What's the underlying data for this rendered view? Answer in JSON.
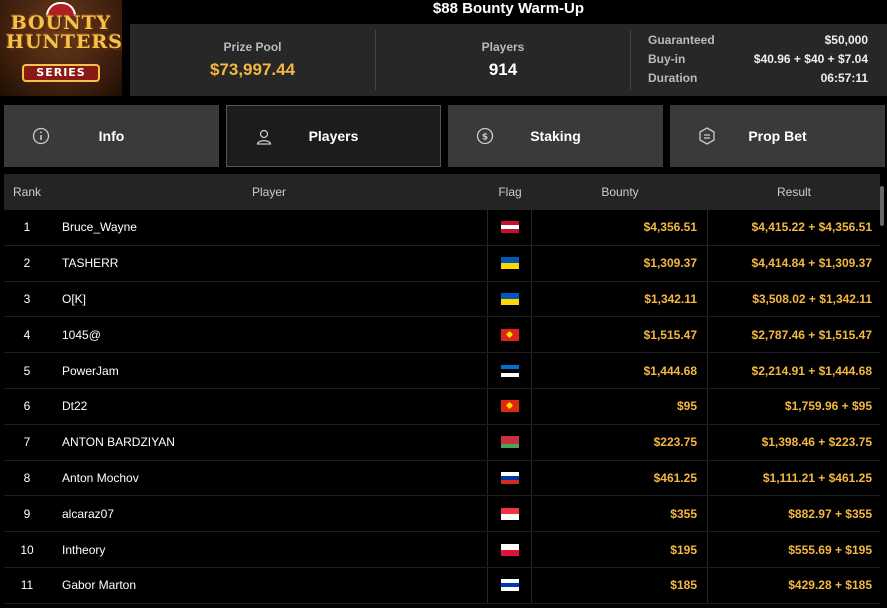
{
  "title": "$88 Bounty Warm-Up",
  "logo": {
    "line1": "BOUNTY",
    "line2": "HUNTERS",
    "line3": "SERIES"
  },
  "summary": {
    "prize_pool_label": "Prize Pool",
    "prize_pool_value": "$73,997.44",
    "players_label": "Players",
    "players_value": "914",
    "details": [
      {
        "label": "Guaranteed",
        "value": "$50,000"
      },
      {
        "label": "Buy-in",
        "value": "$40.96 + $40 + $7.04"
      },
      {
        "label": "Duration",
        "value": "06:57:11"
      }
    ]
  },
  "tabs": [
    {
      "label": "Info",
      "icon": "info-icon"
    },
    {
      "label": "Players",
      "icon": "user-icon",
      "active": true
    },
    {
      "label": "Staking",
      "icon": "staking-icon"
    },
    {
      "label": "Prop Bet",
      "icon": "prop-bet-icon"
    }
  ],
  "table": {
    "headers": {
      "rank": "Rank",
      "player": "Player",
      "flag": "Flag",
      "bounty": "Bounty",
      "result": "Result"
    },
    "rows": [
      {
        "rank": "1",
        "player": "Bruce_Wayne",
        "flag": [
          "#c8102e",
          "#ffffff",
          "#c8102e"
        ],
        "bounty": "$4,356.51",
        "result": "$4,415.22 + $4,356.51"
      },
      {
        "rank": "2",
        "player": "TASHERR",
        "flag": [
          "#0057b7",
          "#ffd700"
        ],
        "bounty": "$1,309.37",
        "result": "$4,414.84 + $1,309.37"
      },
      {
        "rank": "3",
        "player": "O[K]",
        "flag": [
          "#0057b7",
          "#ffd700"
        ],
        "bounty": "$1,342.11",
        "result": "$3,508.02 + $1,342.11"
      },
      {
        "rank": "4",
        "player": "1045@",
        "flag": [
          "#da251d"
        ],
        "bounty": "$1,515.47",
        "result": "$2,787.46 + $1,515.47"
      },
      {
        "rank": "5",
        "player": "PowerJam",
        "flag": [
          "#0072ce",
          "#000000",
          "#ffffff"
        ],
        "bounty": "$1,444.68",
        "result": "$2,214.91 + $1,444.68"
      },
      {
        "rank": "6",
        "player": "Dt22",
        "flag": [
          "#de2910"
        ],
        "bounty": "$95",
        "result": "$1,759.96 + $95"
      },
      {
        "rank": "7",
        "player": "ANTON BARDZIYAN",
        "flag": [
          "#c8313e",
          "#c8313e",
          "#4aa657"
        ],
        "bounty": "$223.75",
        "result": "$1,398.46 + $223.75"
      },
      {
        "rank": "8",
        "player": "Anton Mochov",
        "flag": [
          "#ffffff",
          "#0039a6",
          "#d52b1e"
        ],
        "bounty": "$461.25",
        "result": "$1,111.21 + $461.25"
      },
      {
        "rank": "9",
        "player": "alcaraz07",
        "flag": [
          "#ef3340",
          "#ffffff"
        ],
        "bounty": "$355",
        "result": "$882.97 + $355"
      },
      {
        "rank": "10",
        "player": "Intheory",
        "flag": [
          "#ffffff",
          "#dc143c"
        ],
        "bounty": "$195",
        "result": "$555.69 + $195"
      },
      {
        "rank": "11",
        "player": "Gabor Marton",
        "flag": [
          "#ffffff",
          "#0038b8",
          "#ffffff"
        ],
        "bounty": "$185",
        "result": "$429.28 + $185"
      }
    ]
  }
}
